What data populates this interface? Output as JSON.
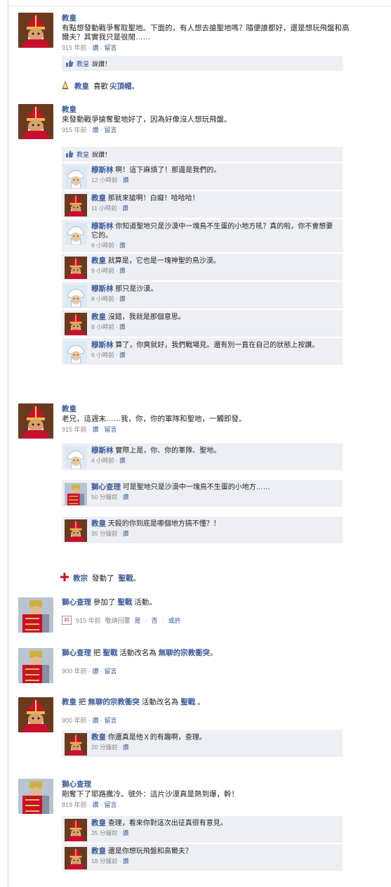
{
  "colors": {
    "link": "#3b5998",
    "comment_bg": "#edeff4",
    "meta": "#888888"
  },
  "posts": [
    {
      "name": "教皇",
      "text": "有點想發動戰爭奪取聖地。下面的，有人想去搶聖地嗎？隨便誰都好，還是想玩飛盤和高爾夫？其實我只是很閒……",
      "time": "915 年前",
      "like": "讚",
      "comment": "留言",
      "likebox": {
        "who": "教皇",
        "suffix": "說讚！"
      }
    },
    {
      "name": "教皇",
      "text": "來發動戰爭搶奪聖地好了，因為好像沒人想玩飛盤。",
      "time": "915 年前",
      "like": "讚",
      "comment": "留言",
      "likebox": {
        "who": "教皇",
        "suffix": "說讚！"
      },
      "comments": [
        {
          "name": "穆斯林",
          "text": "啊！這下麻煩了！那邊是我們的。",
          "time": "12 小時前",
          "like": "讚"
        },
        {
          "name": "教皇",
          "text": "那就來搶啊！白癡！哈哈哈！",
          "time": "11 小時前",
          "like": "讚"
        },
        {
          "name": "穆斯林",
          "text": "你知道聖地只是沙漠中一塊鳥不生蛋的小地方吼？真的啦，你不會想要它的。",
          "time": "9 小時前",
          "like": "讚"
        },
        {
          "name": "教皇",
          "text": "就算是，它也是一塊神聖的鳥沙漠。",
          "time": "9 小時前",
          "like": "讚"
        },
        {
          "name": "穆斯林",
          "text": "那只是沙漠。",
          "time": "8 小時前",
          "like": "讚"
        },
        {
          "name": "教皇",
          "text": "沒錯，我就是那個意思。",
          "time": "8 小時前",
          "like": "讚"
        },
        {
          "name": "穆斯林",
          "text": "算了，你爽就好，我們戰場見。還有別一直在自己的狀態上按讚。",
          "time": "6 小時前",
          "like": "讚"
        }
      ]
    },
    {
      "name": "教皇",
      "text": "老兄，這週末……我，你，你的軍隊和聖地，一觸即發。",
      "time": "915 年前",
      "like": "讚",
      "comment": "留言",
      "comments": [
        {
          "name": "穆斯林",
          "text": "實際上是，你、你的軍隊、聖地。",
          "time": "4 小時前",
          "like": "讚"
        },
        {
          "name": "獅心查理",
          "text": "可是聖地只是沙漠中一塊鳥不生蛋的小地方……",
          "time": "50 分鐘前",
          "like": "讚"
        },
        {
          "name": "教皇",
          "text": "天殺的你到底是哪個地方搞不懂？！",
          "time": "35 分鐘前",
          "like": "讚"
        }
      ]
    }
  ],
  "stories": {
    "s1": {
      "who": "教皇",
      "verb": "喜歡",
      "obj": "尖頂帽",
      "end": "。"
    },
    "s2": {
      "who": "教宗",
      "verb": "發動了",
      "obj": "聖戰",
      "end": "。"
    }
  },
  "events": {
    "e1": {
      "name": "獅心查理",
      "verb": "參加了",
      "obj": "聖戰",
      "suffix": "活動。",
      "cal": "31",
      "time": "915 年前",
      "status": "敬請回覆",
      "yes": "是",
      "no": "否",
      "maybe": "或許"
    },
    "e2": {
      "name": "獅心查理",
      "p1": "把",
      "obj1": "聖戰",
      "p2": "活動改名為",
      "obj2": "無聊的宗教衝突",
      "end": "。",
      "time": "900 年前",
      "like": "讚",
      "comment": "留言"
    },
    "e3": {
      "name": "教皇",
      "p1": "把",
      "obj1": "無聊的宗教衝突",
      "p2": "活動改名為",
      "obj2": "聖戰",
      "end": "。",
      "time": "900 年前",
      "like": "讚",
      "comment": "留言",
      "comment_item": {
        "name": "教皇",
        "text": "你還真是他Ｘ的有趣啊，查理。",
        "time": "20 分鐘前",
        "like": "讚"
      }
    },
    "e4": {
      "name": "獅心查理",
      "text": "剛奪下了耶路撒冷。號外：這片沙漠真是熱到爆，幹！",
      "time": "819 年前",
      "like": "讚",
      "comment": "留言",
      "comments": [
        {
          "name": "教皇",
          "text": "查理，看來你對這次出征真很有意見。",
          "time": "25 分鐘前",
          "like": "讚"
        },
        {
          "name": "教皇",
          "text": "還是你想玩飛盤和高爾夫？",
          "time": "18 分鐘前",
          "like": "讚"
        }
      ]
    }
  }
}
